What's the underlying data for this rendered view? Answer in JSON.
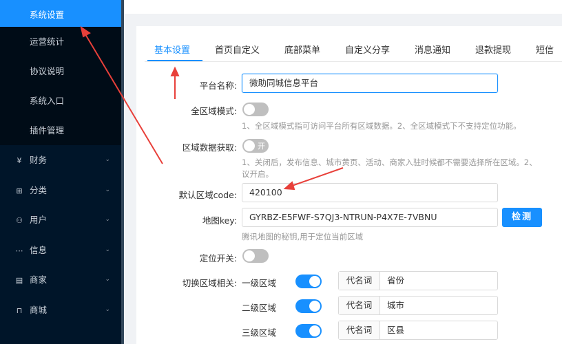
{
  "sidebar": {
    "sub_items": [
      {
        "label": "系统设置",
        "active": true
      },
      {
        "label": "运营统计"
      },
      {
        "label": "协议说明"
      },
      {
        "label": "系统入口"
      },
      {
        "label": "插件管理"
      }
    ],
    "menus": [
      {
        "label": "财务",
        "icon": "yen-icon",
        "glyph": "¥"
      },
      {
        "label": "分类",
        "icon": "grid-icon",
        "glyph": "⊞"
      },
      {
        "label": "用户",
        "icon": "user-icon",
        "glyph": "⚇"
      },
      {
        "label": "信息",
        "icon": "message-icon",
        "glyph": "⋯"
      },
      {
        "label": "商家",
        "icon": "store-icon",
        "glyph": "▤"
      },
      {
        "label": "商城",
        "icon": "shop-bag-icon",
        "glyph": "⊓"
      }
    ],
    "chevron": "⌄"
  },
  "tabs": [
    "基本设置",
    "首页自定义",
    "底部菜单",
    "自定义分享",
    "消息通知",
    "退款提现",
    "短信"
  ],
  "form": {
    "platform_name": {
      "label": "平台名称:",
      "value": "微助同城信息平台"
    },
    "all_region_mode": {
      "label": "全区域模式:",
      "on": false,
      "hint": "1、全区域模式指可访问平台所有区域数据。2、全区域模式下不支持定位功能。"
    },
    "region_fetch": {
      "label": "区域数据获取:",
      "switch_text": "开",
      "hint_line1": "1、关闭后，发布信息、城市黄页、活动、商家入驻时候都不需要选择所在区域。2、",
      "hint_line2": "议开启。"
    },
    "default_region": {
      "label": "默认区域code:",
      "value": "420100"
    },
    "map_key": {
      "label": "地图key:",
      "value": "GYRBZ-E5FWF-S7QJ3-NTRUN-P4X7E-7VBNU",
      "button": "检测",
      "hint": "腾讯地图的秘钥,用于定位当前区域"
    },
    "location_switch": {
      "label": "定位开关:",
      "on": false
    },
    "switch_region": {
      "label": "切换区域相关:",
      "levels": [
        {
          "name": "一级区域",
          "on": true,
          "alias_label": "代名词",
          "alias": "省份"
        },
        {
          "name": "二级区域",
          "on": true,
          "alias_label": "代名词",
          "alias": "城市"
        },
        {
          "name": "三级区域",
          "on": true,
          "alias_label": "代名词",
          "alias": "区县"
        }
      ]
    }
  },
  "colors": {
    "primary": "#1890ff",
    "sidebar": "#001529",
    "arrow": "#e8403a"
  }
}
